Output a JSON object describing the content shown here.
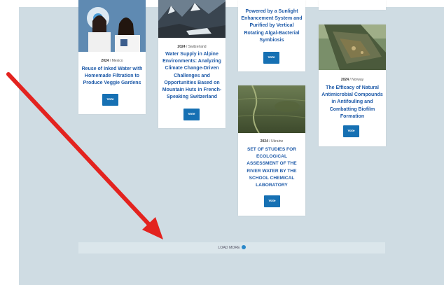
{
  "cards": [
    {
      "meta_year": "2024",
      "meta_country": "Mexico",
      "title": "Reuse of Inked Water with Homemade Filtration to Produce Veggie Gardens",
      "vote_label": "Vote"
    },
    {
      "meta_year": "2024",
      "meta_country": "Switzerland",
      "title": "Water Supply in Alpine Environments: Analyzing Climate Change-Driven Challenges and Opportunities Based on Mountain Huts in French-Speaking Switzerland",
      "vote_label": "Vote"
    },
    {
      "title": "Powered by a Sunlight Enhancement System and Purified by Vertical Rotating Algal-Bacterial Symbiosis",
      "vote_label": "Vote"
    },
    {
      "meta_year": "2024",
      "meta_country": "Ukraine",
      "title": "SET OF STUDIES FOR ECOLOGICAL ASSESSMENT OF THE RIVER WATER BY THE SCHOOL CHEMICAL LABORATORY",
      "vote_label": "Vote"
    },
    {
      "meta_year": "2024",
      "meta_country": "Norway",
      "title": "The Efficacy of Natural Antimicrobial Compounds in Antifouling and Combatting Biofilm Formation",
      "vote_label": "Vote"
    }
  ],
  "load_more_label": "LOAD MORE",
  "colors": {
    "background": "#cfdce3",
    "title_blue": "#1e5aa8",
    "vote_button": "#1670b3",
    "annotation_arrow": "#e3231f"
  },
  "icons": {
    "load_more": "chevron-down-circle-icon"
  }
}
